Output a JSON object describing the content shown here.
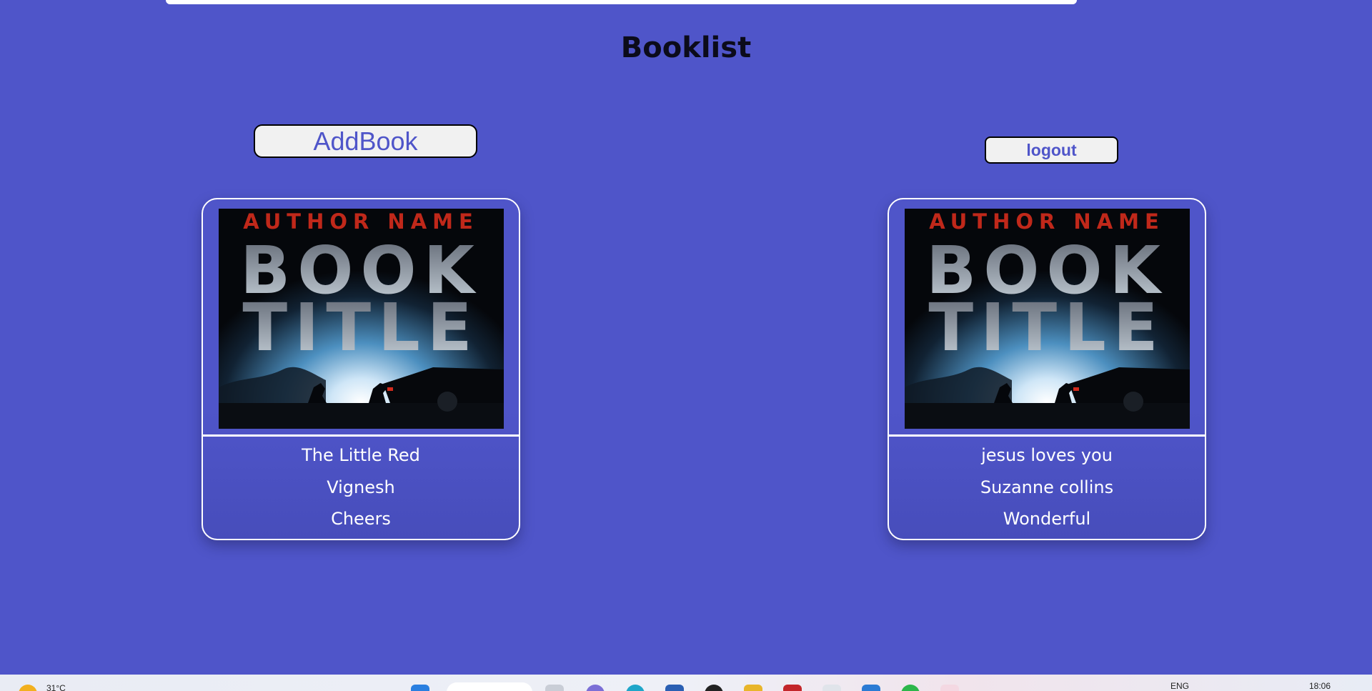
{
  "page": {
    "title": "Booklist"
  },
  "actions": {
    "add_label": "AddBook",
    "logout_label": "logout"
  },
  "books": [
    {
      "title": "The Little Red",
      "author": "Vignesh",
      "description": "Cheers",
      "cover": {
        "author_text": "AUTHOR NAME",
        "title_line1": "BOOK",
        "title_line2": "TITLE"
      }
    },
    {
      "title": "jesus loves you",
      "author": "Suzanne collins",
      "description": "Wonderful",
      "cover": {
        "author_text": "AUTHOR NAME",
        "title_line1": "BOOK",
        "title_line2": "TITLE"
      }
    }
  ],
  "taskbar": {
    "temperature": "31°C",
    "language": "ENG",
    "time": "18:06"
  },
  "colors": {
    "background": "#4f55c9",
    "accent_text": "#4f55c9",
    "cover_author_red": "#c0281a"
  }
}
